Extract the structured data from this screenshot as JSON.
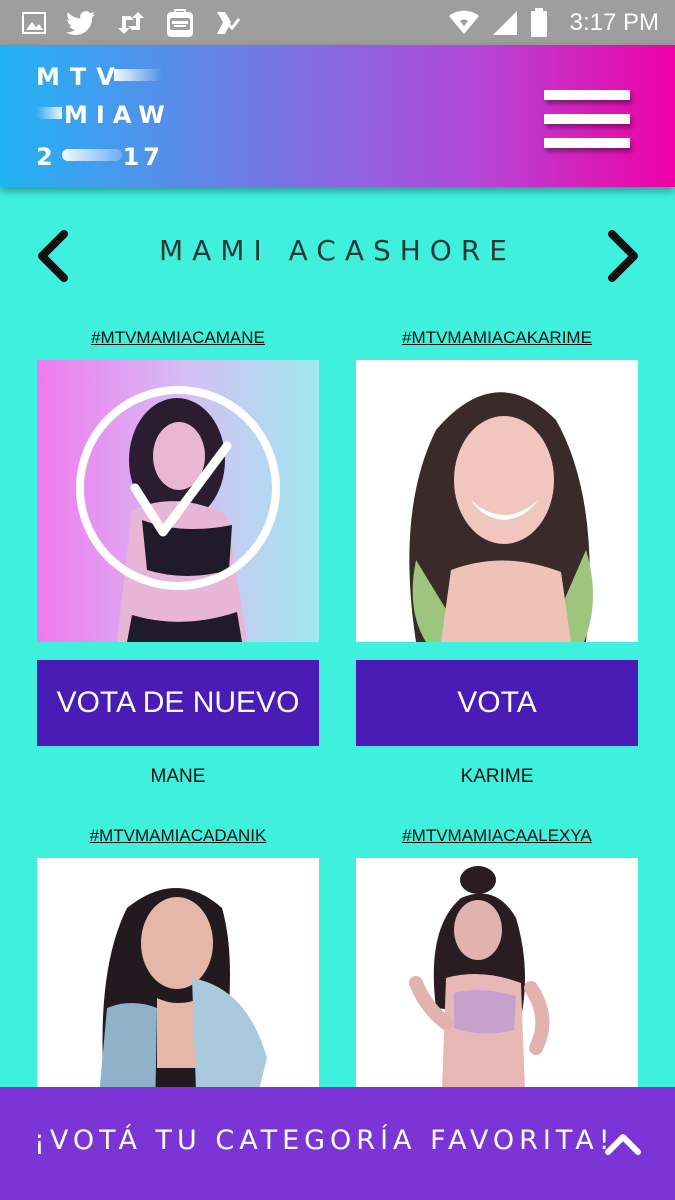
{
  "status_bar": {
    "time": "3:17 PM",
    "icons": [
      "image-icon",
      "twitter-icon",
      "retweet-icon",
      "shopping-bag-icon",
      "check-app-icon",
      "wifi-icon",
      "signal-icon",
      "battery-icon"
    ]
  },
  "header": {
    "logo": {
      "line1": "MTV",
      "line2": "MIAW",
      "year_left": "2",
      "year_right": "17"
    },
    "menu_icon": "hamburger-menu-icon"
  },
  "category": {
    "title": "MAMI ACASHORE",
    "prev_icon": "chevron-left-icon",
    "next_icon": "chevron-right-icon"
  },
  "nominees": [
    {
      "hashtag": "#MTVMAMIACAMANE",
      "button": "VOTA DE NUEVO",
      "name": "MANE",
      "voted": true
    },
    {
      "hashtag": "#MTVMAMIACAKARIME",
      "button": "VOTA",
      "name": "KARIME",
      "voted": false
    },
    {
      "hashtag": "#MTVMAMIACADANIK",
      "button": "",
      "name": "",
      "voted": false
    },
    {
      "hashtag": "#MTVMAMIACAALEXYA",
      "button": "",
      "name": "",
      "voted": false
    }
  ],
  "footer": {
    "text": "¡VOTÁ TU CATEGORÍA FAVORITA!",
    "icon": "chevron-up-icon"
  },
  "colors": {
    "background": "#3ff0dd",
    "header_start": "#22b3f5",
    "header_end": "#f000a6",
    "button": "#4b1bb5",
    "footer": "#7b35d6"
  }
}
